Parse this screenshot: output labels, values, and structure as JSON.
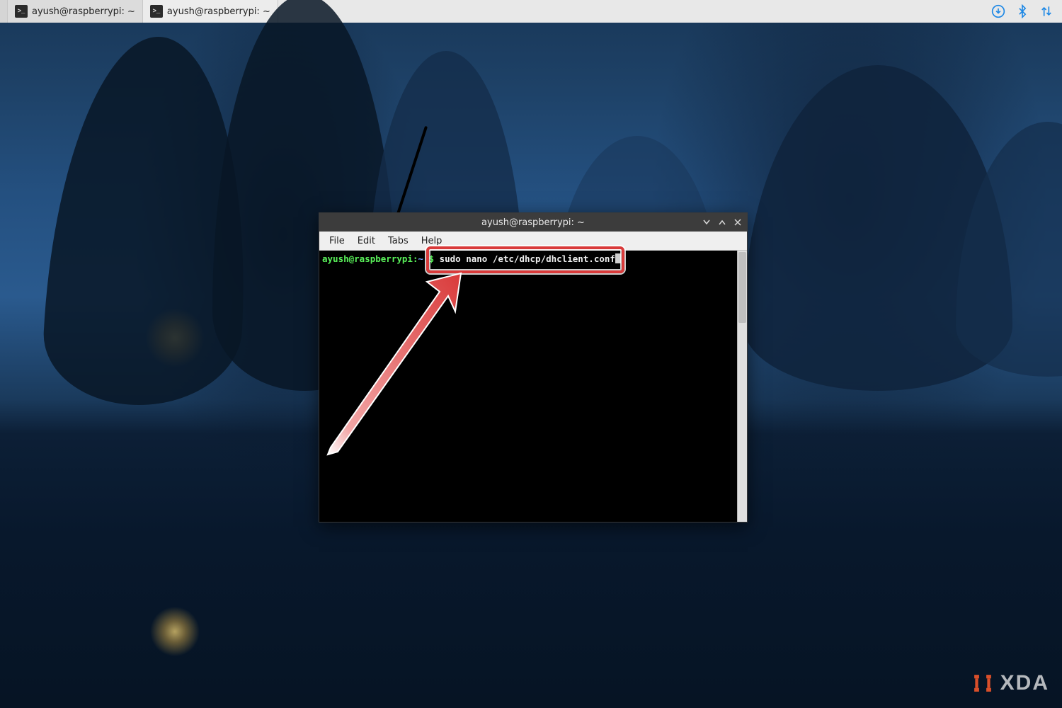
{
  "taskbar": {
    "items": [
      {
        "label": "ayush@raspberrypi: ~",
        "active": true
      },
      {
        "label": "ayush@raspberrypi: ~",
        "active": false
      }
    ],
    "tray": {
      "download_icon": "download-icon",
      "bluetooth_icon": "bluetooth-icon",
      "network_icon": "network-updown-icon"
    }
  },
  "terminal": {
    "title": "ayush@raspberrypi: ~",
    "menu": {
      "file": "File",
      "edit": "Edit",
      "tabs": "Tabs",
      "help": "Help"
    },
    "prompt": {
      "userhost": "ayush@raspberrypi",
      "sep": ":",
      "path": "~",
      "end": " $ "
    },
    "command": "sudo nano /etc/dhcp/dhclient.conf"
  },
  "watermark": {
    "text": "XDA"
  },
  "colors": {
    "accent": "#1e88e5",
    "annotation": "#d93a3a",
    "terminal_bg": "#000000",
    "prompt_green": "#5af25a"
  }
}
